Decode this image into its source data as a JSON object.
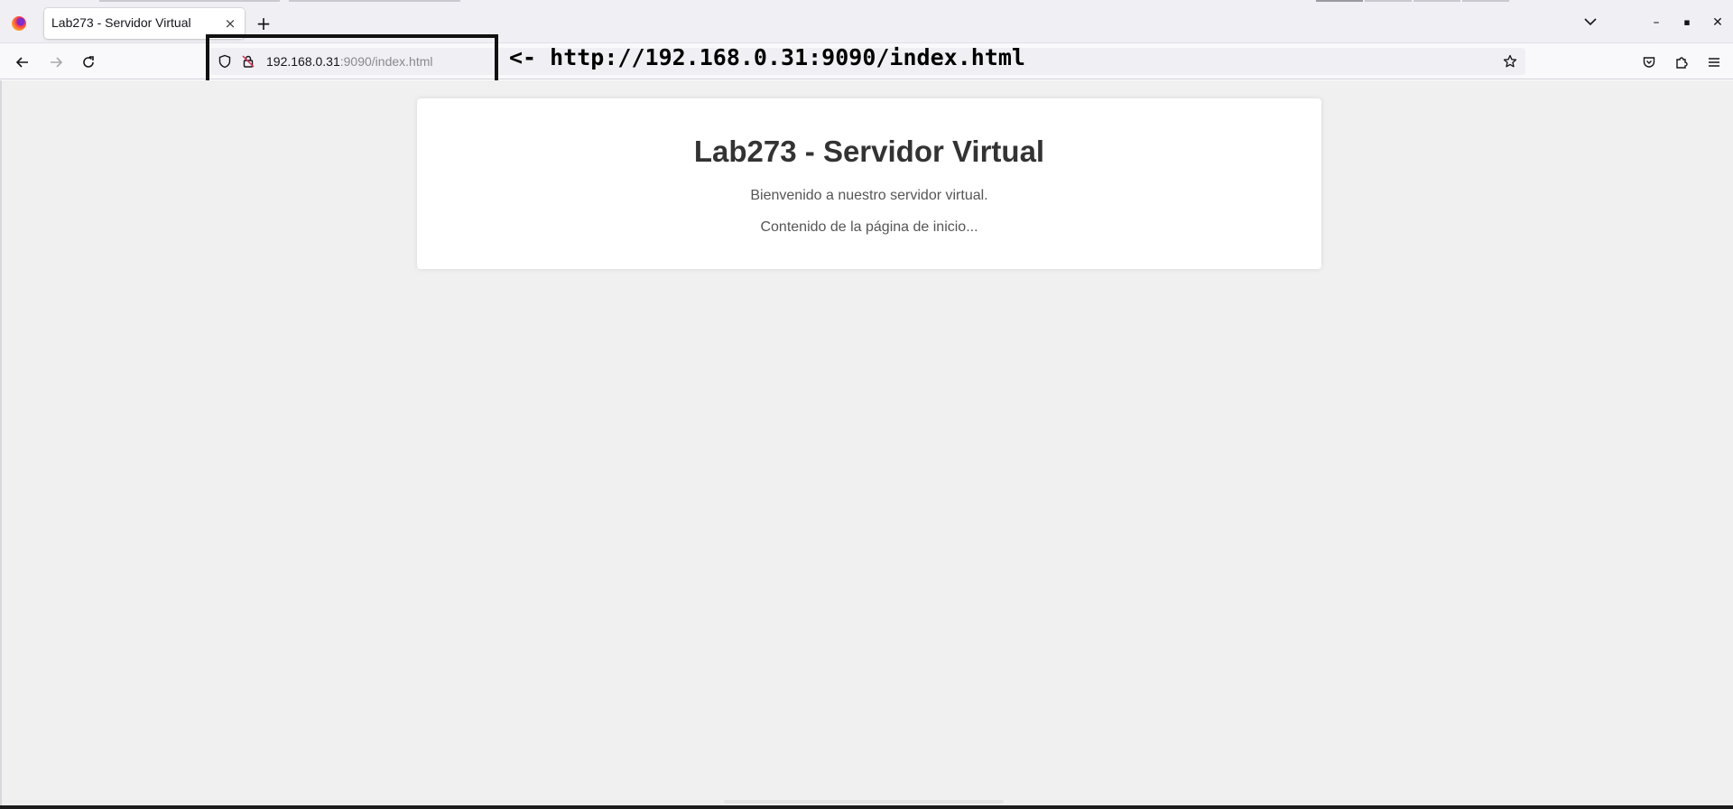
{
  "window": {
    "title": "Lab273 - Servidor Virtual",
    "controls": [
      "minimize-icon",
      "maximize-icon",
      "close-icon"
    ]
  },
  "tabs": [
    {
      "title": "Lab273 - Servidor Virtual",
      "active": true
    }
  ],
  "tab_close_glyph": "×",
  "new_tab_glyph": "+",
  "window_glyphs": {
    "minimize": "–",
    "maximize": "▪",
    "close": "✕"
  },
  "toolbar": {
    "back_icon": "arrow-left-icon",
    "forward_icon": "arrow-right-icon",
    "reload_icon": "reload-icon"
  },
  "address_bar": {
    "host": "192.168.0.31",
    "path": ":9090/index.html",
    "icons": [
      "shield-icon",
      "insecure-lock-icon",
      "bookmark-star-icon"
    ]
  },
  "extensions": [
    "pocket-icon",
    "extensions-icon",
    "menu-icon"
  ],
  "annotation": {
    "text": "<- http://192.168.0.31:9090/index.html"
  },
  "page": {
    "heading": "Lab273 - Servidor Virtual",
    "paragraph1": "Bienvenido a nuestro servidor virtual.",
    "paragraph2": "Contenido de la página de inicio..."
  },
  "colors": {
    "page_background": "#f0f0f0",
    "card_background": "#ffffff",
    "heading": "#333333",
    "body_text": "#555555",
    "highlight_box": "#111111"
  }
}
